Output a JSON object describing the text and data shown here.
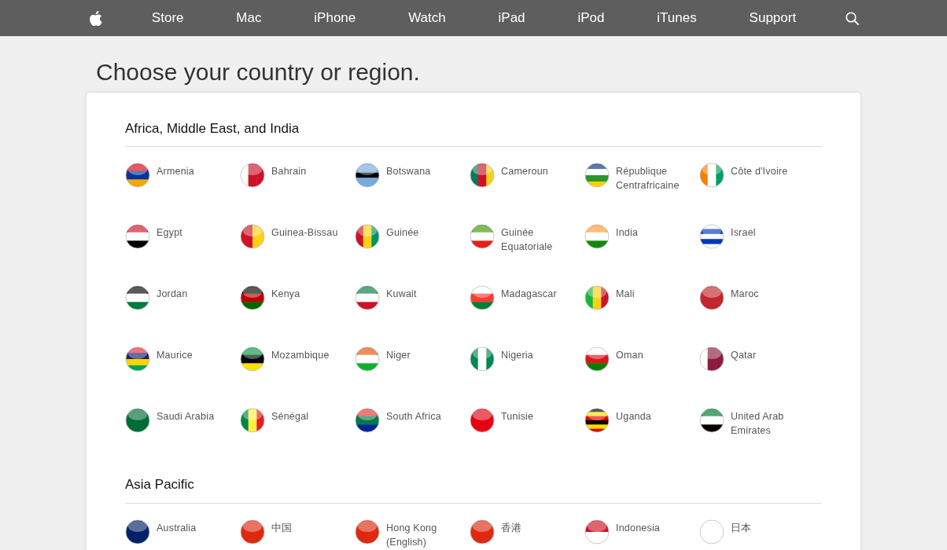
{
  "nav": {
    "items": [
      "Store",
      "Mac",
      "iPhone",
      "Watch",
      "iPad",
      "iPod",
      "iTunes",
      "Support"
    ]
  },
  "title": "Choose your country or region.",
  "sections": [
    {
      "heading": "Africa, Middle East, and India",
      "countries": [
        "Armenia",
        "Bahrain",
        "Botswana",
        "Cameroun",
        "République Centrafricaine",
        "Côte d'Ivoire",
        "Egypt",
        "Guinea-Bissau",
        "Guinée",
        "Guinée Equatoriale",
        "India",
        "Israel",
        "Jordan",
        "Kenya",
        "Kuwait",
        "Madagascar",
        "Mali",
        "Maroc",
        "Maurice",
        "Mozambique",
        "Niger",
        "Nigeria",
        "Oman",
        "Qatar",
        "Saudi Arabia",
        "Sénégal",
        "South Africa",
        "Tunisie",
        "Uganda",
        "United Arab Emirates"
      ]
    },
    {
      "heading": "Asia Pacific",
      "countries": [
        "Australia",
        "中国",
        "Hong Kong (English)",
        "香港",
        "Indonesia",
        "日本"
      ]
    }
  ]
}
